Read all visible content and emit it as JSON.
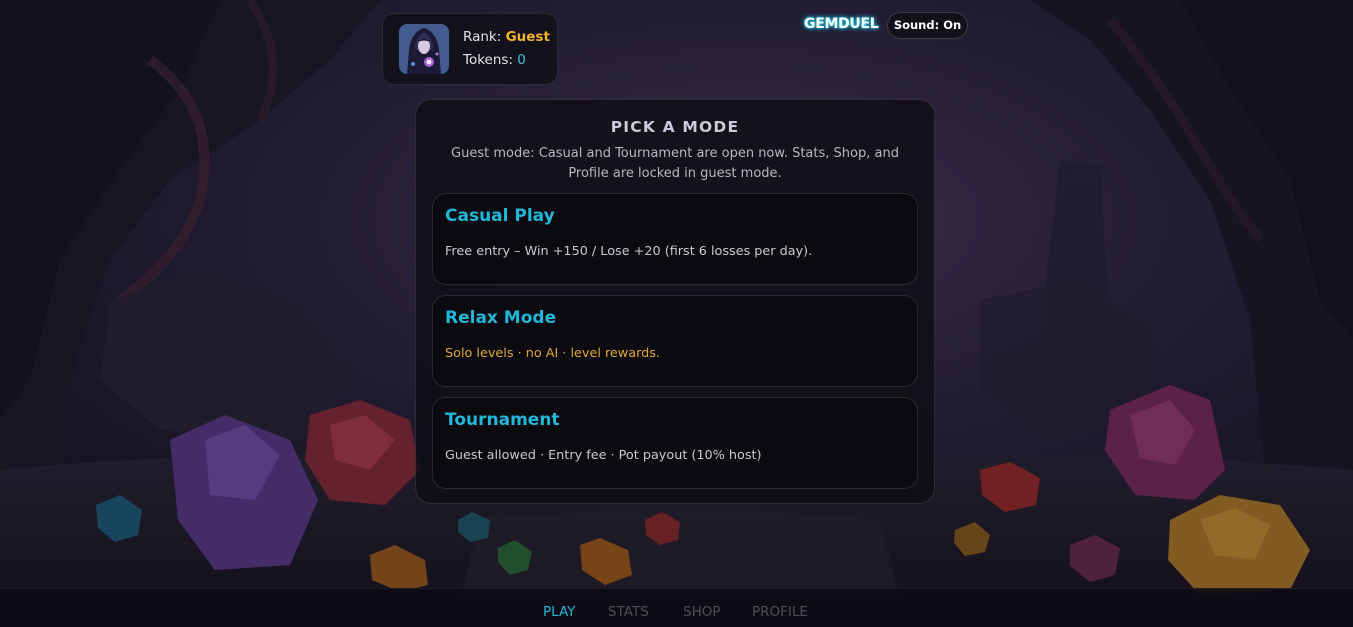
{
  "header": {
    "rank_label": "Rank:",
    "rank_value": "Guest",
    "tokens_label": "Tokens:",
    "tokens_value": "0",
    "logo_text": "GEMDUEL",
    "sound_label": "Sound: On"
  },
  "panel": {
    "title": "PICK A MODE",
    "subtitle": "Guest mode: Casual and Tournament are open now. Stats, Shop, and Profile are locked in guest mode.",
    "modes": [
      {
        "name": "Casual Play",
        "description": "Free entry – Win +150 / Lose +20 (first 6 losses per day)."
      },
      {
        "name": "Relax Mode",
        "description": "Solo levels · no AI · level rewards."
      },
      {
        "name": "Tournament",
        "description": "Guest allowed · Entry fee · Pot payout (10% host)"
      }
    ]
  },
  "nav": {
    "items": [
      {
        "label": "PLAY",
        "active": true
      },
      {
        "label": "STATS",
        "active": false
      },
      {
        "label": "SHOP",
        "active": false
      },
      {
        "label": "PROFILE",
        "active": false
      }
    ]
  },
  "colors": {
    "accent": "#25b6dc",
    "rank_gold": "#f5b32b",
    "relax_gold": "#e2a82d",
    "background": "#1c1a2c"
  },
  "icons": {
    "avatar": "hooded-mage-avatar"
  }
}
